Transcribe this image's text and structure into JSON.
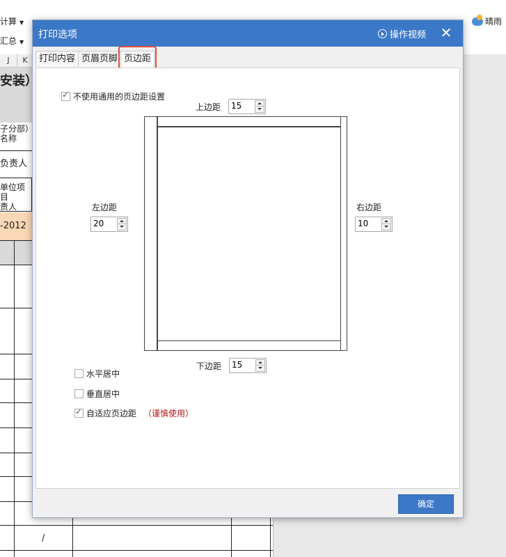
{
  "toolbar": {
    "calc_label": "计算",
    "summary_label": "汇总",
    "weather_label": "晴雨"
  },
  "sheet": {
    "col_headers": [
      "J",
      "K"
    ],
    "title_fragment": "安装）",
    "row_texts": [
      "子分部）",
      "名称",
      "负责人",
      "单位项目",
      "责人",
      "-2012"
    ],
    "slash": "/"
  },
  "dialog": {
    "title": "打印选项",
    "video_label": "操作视频",
    "tabs": [
      {
        "label": "打印内容"
      },
      {
        "label": "页眉页脚"
      },
      {
        "label": "页边距"
      }
    ],
    "use_global_margin": {
      "label": "不使用通用的页边距设置",
      "checked": true
    },
    "margins": {
      "top": {
        "label": "上边距",
        "value": "15"
      },
      "left": {
        "label": "左边距",
        "value": "20"
      },
      "right": {
        "label": "右边距",
        "value": "10"
      },
      "bottom": {
        "label": "下边距",
        "value": "15"
      }
    },
    "center_horizontal": {
      "label": "水平居中",
      "checked": false
    },
    "center_vertical": {
      "label": "垂直居中",
      "checked": false
    },
    "auto_fit": {
      "label": "自适应页边距",
      "checked": true,
      "note": "（谨慎使用）"
    },
    "ok_label": "确定"
  },
  "colors": {
    "accent": "#3c78c8",
    "highlight": "#e04a3a",
    "warning": "#b41818",
    "cell_orange": "#fad7b5"
  }
}
